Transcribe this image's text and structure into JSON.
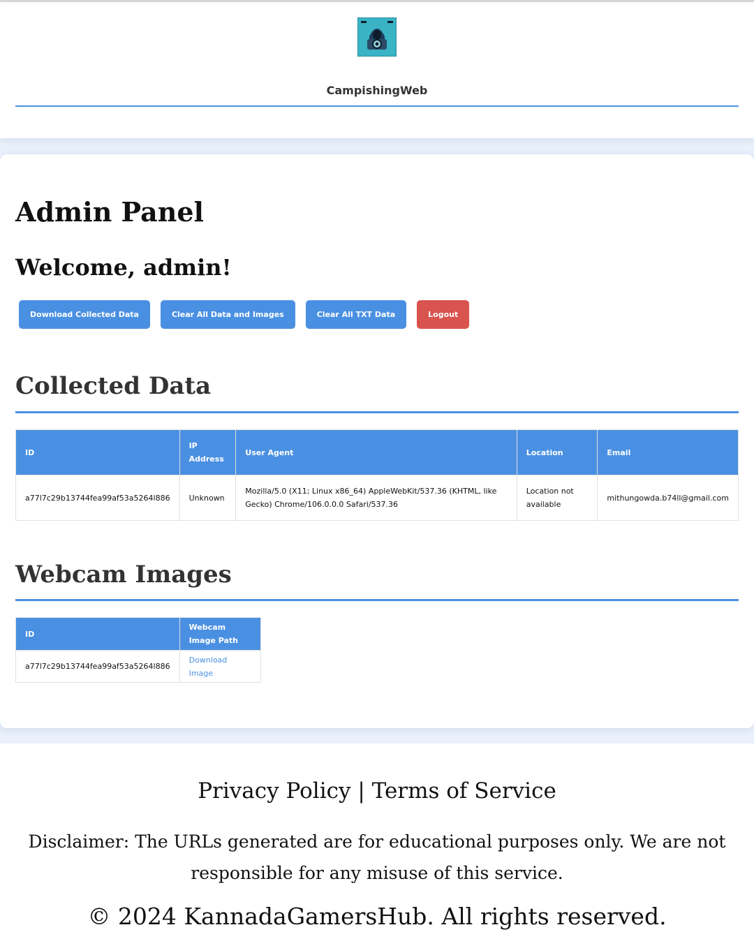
{
  "site": {
    "name": "CampishingWeb",
    "logo_icon": "hooded-hacker-webcam-logo"
  },
  "panel": {
    "title": "Admin Panel",
    "welcome": "Welcome, admin!",
    "buttons": {
      "download": "Download Collected Data",
      "clear_all": "Clear All Data and Images",
      "clear_txt": "Clear All TXT Data",
      "logout": "Logout"
    }
  },
  "collected": {
    "title": "Collected Data",
    "headers": [
      "ID",
      "IP Address",
      "User Agent",
      "Location",
      "Email"
    ],
    "rows": [
      {
        "id": "a77l7c29b13744fea99af53a5264l886",
        "ip": "Unknown",
        "user_agent": "Mozilla/5.0 (X11; Linux x86_64) AppleWebKit/537.36 (KHTML, like Gecko) Chrome/106.0.0.0 Safari/537.36",
        "location": "Location not available",
        "email": "mithungowda.b74ll@gmail.com"
      }
    ]
  },
  "webcam": {
    "title": "Webcam Images",
    "headers": [
      "ID",
      "Webcam Image Path"
    ],
    "rows": [
      {
        "id": "a77l7c29b13744fea99af53a5264l886",
        "link": "Download Image"
      }
    ]
  },
  "footer": {
    "privacy": "Privacy Policy",
    "separator": "|",
    "terms": "Terms of Service",
    "disclaimer": "Disclaimer: The URLs generated are for educational purposes only. We are not responsible for any misuse of this service.",
    "copyright": "© 2024 KannadaGamersHub. All rights reserved."
  },
  "colors": {
    "accent": "#4a90e2",
    "danger": "#d9534f",
    "logo_bg": "#3ab3c4"
  }
}
